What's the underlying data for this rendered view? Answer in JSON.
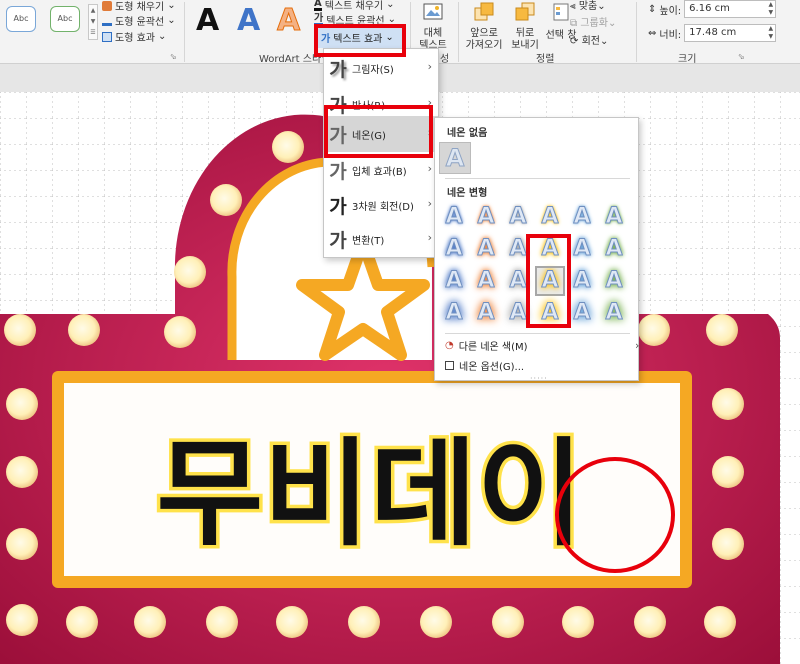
{
  "ribbon": {
    "shape_styles": {
      "samples": [
        "Abc",
        "Abc"
      ],
      "fill_label": "도형 채우기",
      "outline_label": "도형 윤곽선",
      "effects_label": "도형 효과"
    },
    "wordart": {
      "samples": [
        "A",
        "A",
        "A"
      ],
      "group_label": "WordArt 스타일",
      "text_fill_label": "텍스트 채우기",
      "text_outline_label": "텍스트 윤곽선",
      "text_effects_label": "텍스트 효과"
    },
    "accessibility": {
      "alt_text_label": "대체 텍스트",
      "alt_text_line1": "대체",
      "alt_text_line2": "텍스트",
      "group_label_partial": "성"
    },
    "arrange": {
      "bring_forward_line1": "앞으로",
      "bring_forward_line2": "가져오기",
      "send_backward_line1": "뒤로",
      "send_backward_line2": "보내기",
      "selection_pane_label": "선택 창",
      "align_label": "맞춤",
      "group_label_cmd": "그룹화",
      "rotate_label": "회전",
      "group_label": "정렬"
    },
    "size": {
      "height_label": "높이:",
      "height_value": "6.16 cm",
      "width_label": "너비:",
      "width_value": "17.48 cm",
      "group_label": "크기"
    }
  },
  "text_effects_menu": {
    "items": [
      {
        "glyph": "가",
        "label": "그림자(S)"
      },
      {
        "glyph": "가",
        "label": "반사(R)"
      },
      {
        "glyph": "가",
        "label": "네온(G)"
      },
      {
        "glyph": "가",
        "label": "입체 효과(B)"
      },
      {
        "glyph": "가",
        "label": "3차원 회전(D)"
      },
      {
        "glyph": "가",
        "label": "변환(T)"
      }
    ],
    "active_item": "네온(G)"
  },
  "glow_gallery": {
    "no_glow_heading": "네온 없음",
    "no_glow_glyph": "A",
    "variations_heading": "네온 변형",
    "tile_glyph": "A",
    "column_colors": [
      "#4472c4",
      "#ed7d31",
      "#a5a5a5",
      "#ffc000",
      "#5b9bd5",
      "#70ad47"
    ],
    "rows": 4,
    "selected_tile": {
      "row": 2,
      "column": 4
    },
    "more_colors_label": "다른 네온 색(M)",
    "options_label": "네온 옵션(G)..."
  },
  "slide": {
    "sign_text": "무비데이",
    "colors": {
      "frame": "#c0174a",
      "bulb": "#fff4c4",
      "border": "#f5a823",
      "text_glow": "#ffe24a"
    }
  },
  "annotations": {
    "highlight_color": "#e8000b"
  }
}
